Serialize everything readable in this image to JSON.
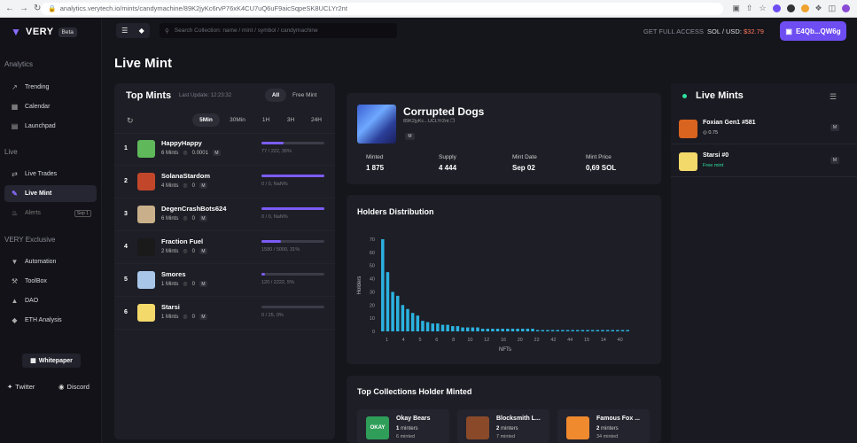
{
  "browser": {
    "url": "analytics.verytech.io/mints/candymachine/89K2jyKc6rvP76xK4CU7uQ6uF9aicSqpeSK8UCLYr2nt"
  },
  "app": {
    "name": "VERY",
    "badge": "Beta",
    "accent": "#6e4df2"
  },
  "sidebar": {
    "sections": [
      {
        "title": "Analytics",
        "items": [
          {
            "label": "Trending",
            "icon": "trending-icon"
          },
          {
            "label": "Calendar",
            "icon": "calendar-icon"
          },
          {
            "label": "Launchpad",
            "icon": "launchpad-icon"
          }
        ]
      },
      {
        "title": "Live",
        "items": [
          {
            "label": "Live Trades",
            "icon": "live-trades-icon"
          },
          {
            "label": "Live Mint",
            "icon": "live-mint-icon",
            "active": true
          },
          {
            "label": "Alerts",
            "icon": "bell-icon",
            "tag": "Sep 1"
          }
        ]
      },
      {
        "title": "VERY Exclusive",
        "items": [
          {
            "label": "Automation",
            "icon": "automation-icon"
          },
          {
            "label": "ToolBox",
            "icon": "toolbox-icon"
          },
          {
            "label": "DAO",
            "icon": "dao-icon"
          },
          {
            "label": "ETH Analysis",
            "icon": "eth-icon"
          }
        ]
      }
    ],
    "whitepaper": "Whitepaper",
    "twitter": "Twitter",
    "discord": "Discord"
  },
  "topbar": {
    "search_placeholder": "Search Collection: name / mint / symbol / candymachine",
    "get_access": "GET FULL ACCESS",
    "sol_usd_label": "SOL / USD:",
    "sol_usd_value": "$32.79",
    "wallet": "E4Qb...QW6g"
  },
  "page_title": "Live Mint",
  "top_mints": {
    "title": "Top Mints",
    "last_update": "Last Update: 12:23:32",
    "filters": [
      "All",
      "Free Mint"
    ],
    "timeframes": [
      "5Min",
      "30Min",
      "1H",
      "3H",
      "24H"
    ],
    "rows": [
      {
        "rank": "1",
        "name": "HappyHappy",
        "mints": "6 Mints",
        "price": "0.0001",
        "progress_text": "77 / 222, 35%",
        "progress": 0.35,
        "color": "#5fb85a"
      },
      {
        "rank": "2",
        "name": "SolanaStardom",
        "mints": "4 Mints",
        "price": "0",
        "progress_text": "0 / 0, NaN%",
        "progress": 1.0,
        "color": "#c2472a"
      },
      {
        "rank": "3",
        "name": "DegenCrashBots624",
        "mints": "6 Mints",
        "price": "0",
        "progress_text": "0 / 0, NaN%",
        "progress": 1.0,
        "color": "#c9b08a"
      },
      {
        "rank": "4",
        "name": "Fraction Fuel",
        "mints": "2 Mints",
        "price": "0",
        "progress_text": "1580 / 5000, 31%",
        "progress": 0.31,
        "color": "#1a1a1a"
      },
      {
        "rank": "5",
        "name": "Smores",
        "mints": "1 Mints",
        "price": "0",
        "progress_text": "120 / 2222, 5%",
        "progress": 0.05,
        "color": "#a8c6e8"
      },
      {
        "rank": "6",
        "name": "Starsi",
        "mints": "1 Mints",
        "price": "0",
        "progress_text": "0 / 25, 0%",
        "progress": 0.0,
        "color": "#f2d96a"
      }
    ]
  },
  "collection": {
    "title": "Corrupted Dogs",
    "address": "89K2jyKc...UCLYr2nt",
    "stats": [
      {
        "label": "Minted",
        "value": "1 875"
      },
      {
        "label": "Supply",
        "value": "4 444"
      },
      {
        "label": "Mint Date",
        "value": "Sep 02"
      },
      {
        "label": "Mint Price",
        "value": "0,69 SOL"
      }
    ]
  },
  "holders": {
    "title": "Holders Distribution"
  },
  "chart_data": {
    "type": "bar",
    "title": "Holders Distribution",
    "xlabel": "NFTs",
    "ylabel": "Holders",
    "categories": [
      "1",
      "2",
      "3",
      "4",
      "5",
      "6",
      "7",
      "8",
      "9",
      "10",
      "11",
      "12",
      "13",
      "14",
      "15",
      "16",
      "17",
      "18",
      "19",
      "20",
      "21",
      "22",
      "23",
      "24",
      "25",
      "26",
      "27",
      "28",
      "29",
      "30",
      "31",
      "32",
      "33",
      "34",
      "35",
      "36",
      "37",
      "38",
      "39",
      "40",
      "41",
      "42",
      "43",
      "44",
      "45",
      "46",
      "47",
      "48",
      "49",
      "50"
    ],
    "x_tick_labels": [
      "1",
      "4",
      "5",
      "6",
      "8",
      "10",
      "12",
      "16",
      "20",
      "22",
      "42",
      "44",
      "15",
      "14",
      "40"
    ],
    "values": [
      70,
      45,
      30,
      27,
      20,
      17,
      14,
      12,
      8,
      7,
      6,
      6,
      5,
      5,
      4,
      4,
      3,
      3,
      3,
      3,
      2,
      2,
      2,
      2,
      2,
      2,
      2,
      2,
      2,
      2,
      2,
      1,
      1,
      1,
      1,
      1,
      1,
      1,
      1,
      1,
      1,
      1,
      1,
      1,
      1,
      1,
      1,
      1,
      1,
      1
    ],
    "ylim": [
      0,
      70
    ],
    "y_ticks": [
      0,
      10,
      20,
      30,
      40,
      50,
      60,
      70
    ],
    "bar_color": "#2bb3e0",
    "grid": false
  },
  "top_collections": {
    "title": "Top Collections Holder Minted",
    "items": [
      {
        "name": "Okay Bears",
        "minters": "1",
        "minters_label": "minters",
        "sub": "6 minted",
        "color": "#2f9e59",
        "logo": "OKAY"
      },
      {
        "name": "Blocksmith L...",
        "minters": "2",
        "minters_label": "minters",
        "sub": "7 minted",
        "color": "#8a4a2a",
        "logo": ""
      },
      {
        "name": "Famous Fox ...",
        "minters": "2",
        "minters_label": "minters",
        "sub": "34 minted",
        "color": "#f08a2e",
        "logo": ""
      }
    ]
  },
  "live_mints": {
    "title": "Live Mints",
    "items": [
      {
        "name": "Foxian Gen1 #581",
        "price": "0.75",
        "price_prefix": "◎",
        "free": false,
        "color": "#d9641f"
      },
      {
        "name": "Starsi #0",
        "price": "Free mint",
        "price_prefix": "",
        "free": true,
        "color": "#f2d96a"
      }
    ]
  }
}
